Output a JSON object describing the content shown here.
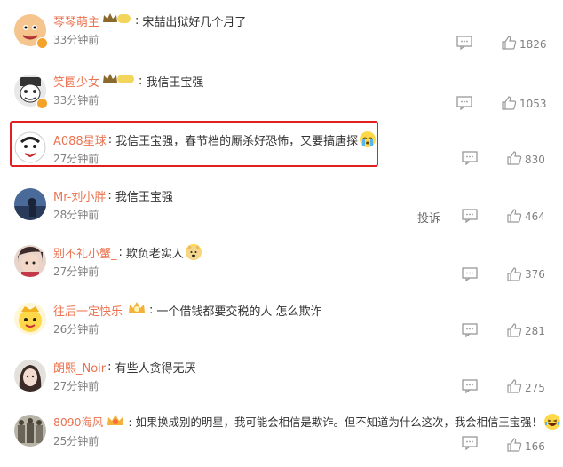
{
  "comments": [
    {
      "user": "琴琴萌主",
      "level": "I",
      "text": "宋喆出狱好几个月了",
      "time": "33分钟前",
      "likes": "1826"
    },
    {
      "user": "笑圆少女",
      "level": "II",
      "text": "我信王宝强",
      "time": "33分钟前",
      "likes": "1053"
    },
    {
      "user": "A088星球",
      "text": "我信王宝强，春节档的厮杀好恐怖，又要搞唐探",
      "time": "27分钟前",
      "likes": "830"
    },
    {
      "user": "Mr-刘小胖",
      "text": "我信王宝强",
      "time": "28分钟前",
      "likes": "464",
      "report": "投诉"
    },
    {
      "user": "别不礼小蟹_",
      "text": "欺负老实人",
      "time": "27分钟前",
      "likes": "376"
    },
    {
      "user": "往后一定快乐",
      "text": "一个借钱都要交税的人 怎么欺诈",
      "time": "26分钟前",
      "likes": "281"
    },
    {
      "user": "朗熙_Noir",
      "text": "有些人贪得无厌",
      "time": "27分钟前",
      "likes": "275"
    },
    {
      "user": "8090海风",
      "text": "如果换成别的明星，我可能会相信是欺诈。但不知道为什么这次，我会相信王宝强！",
      "time": "25分钟前",
      "likes": "166"
    }
  ],
  "colors": {
    "username": "#eb7350",
    "highlight": "#e02020",
    "meta": "#808080"
  }
}
